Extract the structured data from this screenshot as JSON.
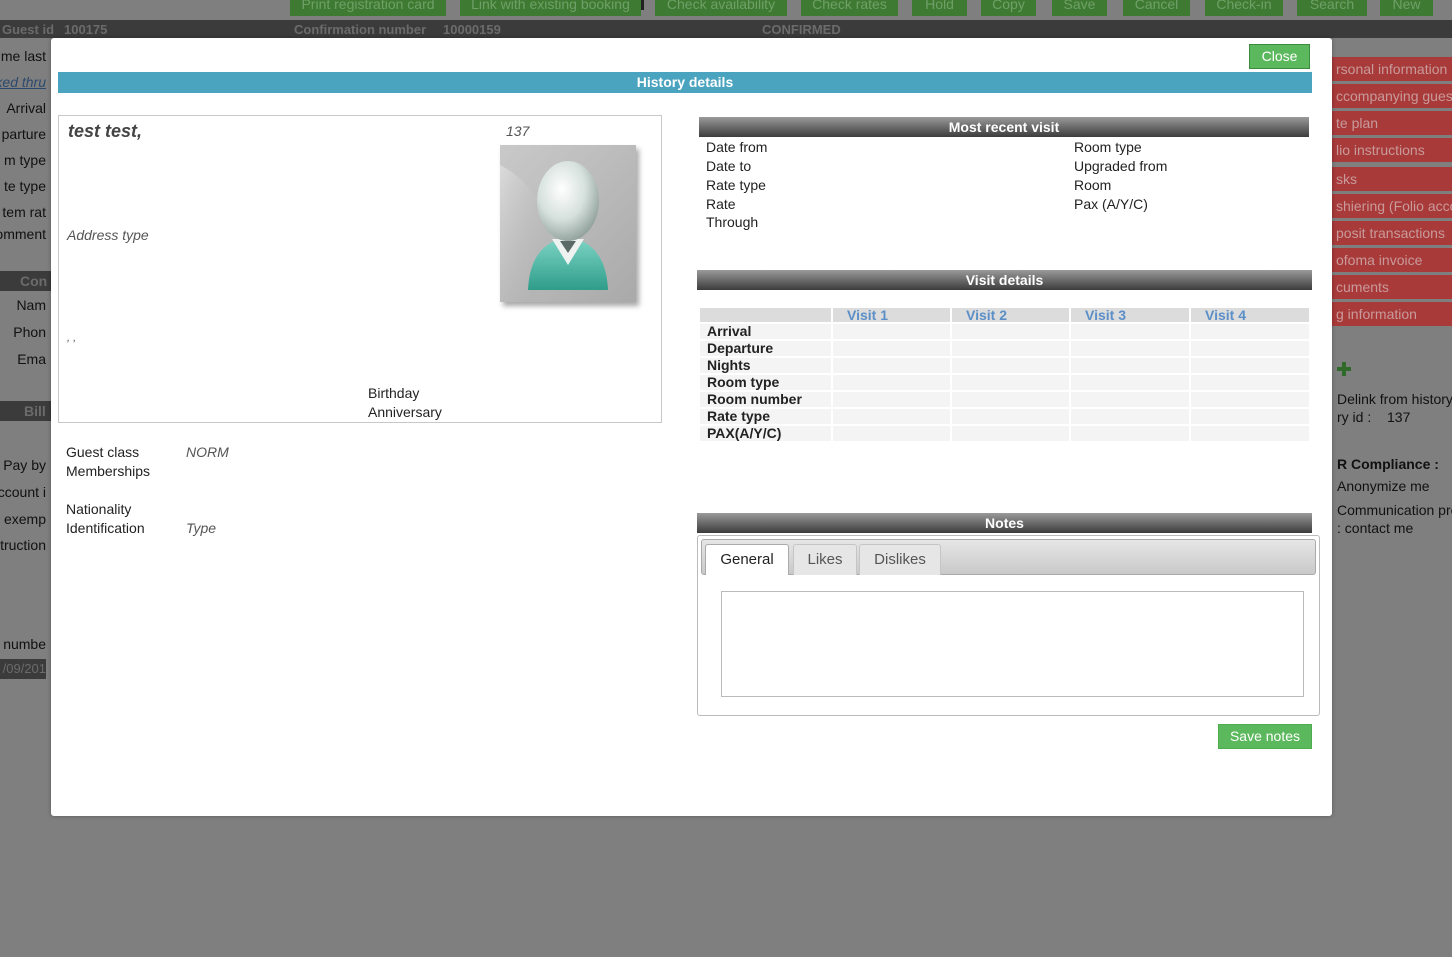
{
  "toolbar": {
    "buttons": [
      "Print registration card",
      "Link with existing booking",
      "Check availability",
      "Check rates",
      "Hold",
      "Copy",
      "Save",
      "Cancel",
      "Check-in",
      "Search",
      "New"
    ]
  },
  "infobar": {
    "guest_id_label": "Guest id",
    "guest_id_value": "100175",
    "confirmation_label": "Confirmation number",
    "confirmation_value": "10000159",
    "status": "CONFIRMED"
  },
  "bg_left": {
    "labels": [
      "me last",
      "ked thru",
      "Arrival",
      "parture",
      "m type",
      "te type",
      "tem rat",
      "omment",
      "Nam",
      "Phon",
      "Ema",
      "Pay by",
      "ccount i",
      "x exemp",
      "truction",
      "numbe"
    ],
    "section_con": "Con",
    "section_bill": "Bill",
    "date": "/09/201"
  },
  "bg_right": {
    "menu": [
      "rsonal information",
      "ccompanying guests",
      "te plan",
      "lio instructions",
      "sks",
      "shiering (Folio acco",
      "posit transactions",
      "ofoma invoice",
      "cuments",
      "g information"
    ],
    "delink": "Delink from history",
    "history_id_label": "ry id :",
    "history_id_value": "137",
    "compliance_title": "R Compliance :",
    "anonymize": "Anonymize me",
    "communication": "Communication pre",
    "contact": ": contact me"
  },
  "modal": {
    "close_label": "Close",
    "title": "History details",
    "guest": {
      "name": "test test,",
      "id": "137",
      "address_type": "Address type",
      "commas": ", ,",
      "birthday_label": "Birthday",
      "anniversary_label": "Anniversary"
    },
    "fields": {
      "guest_class_label": "Guest class",
      "guest_class_value": "NORM",
      "memberships_label": "Memberships",
      "nationality_label": "Nationality",
      "identification_label": "Identification",
      "identification_value": "Type"
    },
    "most_recent": {
      "title": "Most recent visit",
      "left": [
        "Date from",
        "Date to",
        "Rate type",
        "Rate",
        "Through"
      ],
      "right": [
        "Room type",
        "Upgraded from",
        "Room",
        "Pax (A/Y/C)"
      ]
    },
    "visit_details": {
      "title": "Visit details",
      "columns": [
        "Visit 1",
        "Visit 2",
        "Visit 3",
        "Visit 4"
      ],
      "rows": [
        "Arrival",
        "Departure",
        "Nights",
        "Room type",
        "Room number",
        "Rate type",
        "PAX(A/Y/C)"
      ]
    },
    "notes": {
      "title": "Notes",
      "tabs": [
        "General",
        "Likes",
        "Dislikes"
      ],
      "active_tab": "General",
      "text": "",
      "save_label": "Save notes"
    }
  }
}
